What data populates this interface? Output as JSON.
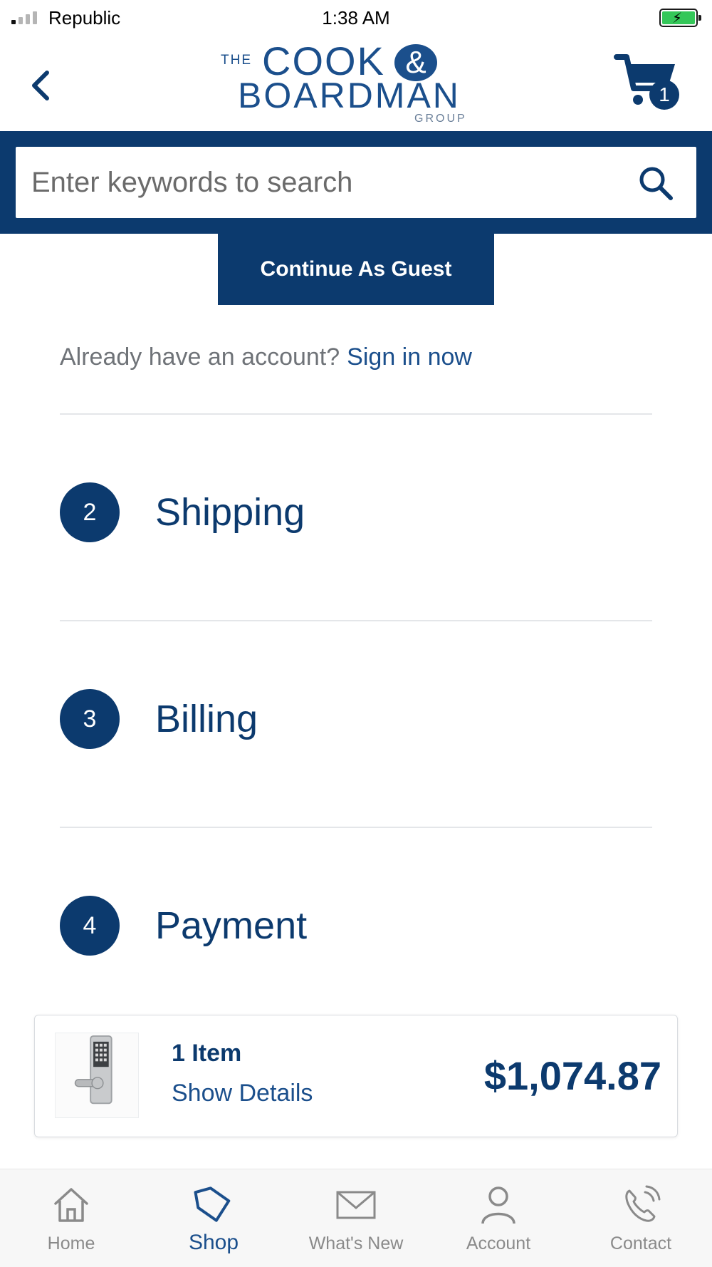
{
  "status_bar": {
    "carrier": "Republic",
    "time": "1:38 AM"
  },
  "header": {
    "logo": {
      "the": "THE",
      "cook": "COOK",
      "amp": "&",
      "boardman": "BOARDMAN",
      "group": "GROUP"
    },
    "cart_count": "1"
  },
  "search": {
    "placeholder": "Enter keywords to search"
  },
  "guest_button": "Continue As Guest",
  "signin": {
    "prompt": "Already have an account?",
    "link": "Sign in now"
  },
  "steps": [
    {
      "number": "2",
      "label": "Shipping"
    },
    {
      "number": "3",
      "label": "Billing"
    },
    {
      "number": "4",
      "label": "Payment"
    }
  ],
  "summary": {
    "count": "1 Item",
    "details_link": "Show Details",
    "total": "$1,074.87"
  },
  "tabbar": [
    {
      "label": "Home",
      "icon": "home-icon",
      "active": false
    },
    {
      "label": "Shop",
      "icon": "tag-icon",
      "active": true
    },
    {
      "label": "What's New",
      "icon": "envelope-icon",
      "active": false
    },
    {
      "label": "Account",
      "icon": "person-icon",
      "active": false
    },
    {
      "label": "Contact",
      "icon": "phone-icon",
      "active": false
    }
  ],
  "colors": {
    "primary_navy": "#0c3a6e",
    "link_blue": "#1b4f8c",
    "battery_green": "#34c759"
  }
}
